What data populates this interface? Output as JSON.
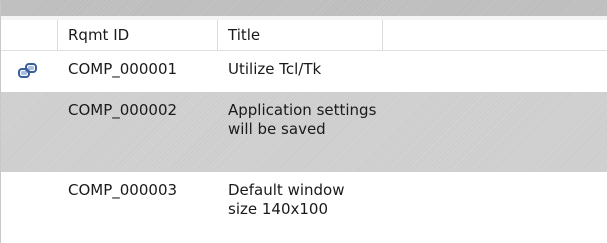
{
  "table": {
    "columns": [
      "",
      "Rqmt ID",
      "Title"
    ],
    "rows": [
      {
        "icon": "link-icon",
        "id": "COMP_000001",
        "title": "Utilize Tcl/Tk",
        "selected": false
      },
      {
        "icon": "",
        "id": "COMP_000002",
        "title": "Application settings will be saved",
        "selected": true
      },
      {
        "icon": "",
        "id": "COMP_000003",
        "title": "Default window size 140x100",
        "selected": false
      }
    ]
  },
  "colors": {
    "selected_row": "#cfcfcf",
    "header_border": "#dcdcdc",
    "icon_accent": "#3a5f9a"
  }
}
